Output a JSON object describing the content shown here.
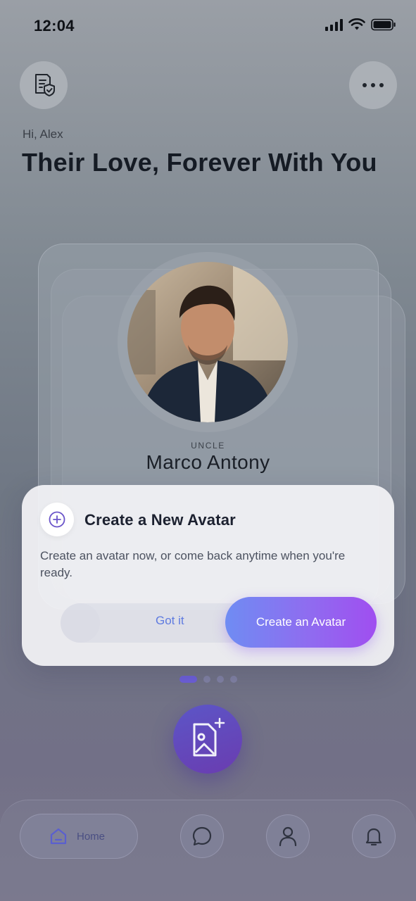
{
  "status_bar": {
    "time": "12:04"
  },
  "header": {
    "greeting": "Hi, Alex",
    "title": "Their Love, Forever With You",
    "left_icon": "document-shield-icon",
    "right_icon": "more-horizontal-icon"
  },
  "avatar_card": {
    "relation": "UNCLE",
    "name": "Marco Antony"
  },
  "modal": {
    "icon": "plus-circle-icon",
    "title": "Create a New Avatar",
    "description": "Create an avatar now, or come back anytime when you're ready.",
    "dismiss_label": "Got it",
    "primary_label": "Create an Avatar"
  },
  "pager": {
    "count": 4,
    "active": 0
  },
  "fab": {
    "icon": "add-image-icon"
  },
  "bottom_nav": {
    "home_label": "Home",
    "items": [
      "chat-bubble-icon",
      "profile-icon",
      "bell-icon"
    ]
  },
  "colors": {
    "accent": "#6d5fd8",
    "primary_gradient_start": "#6f8cf3",
    "primary_gradient_end": "#a04ef0"
  }
}
